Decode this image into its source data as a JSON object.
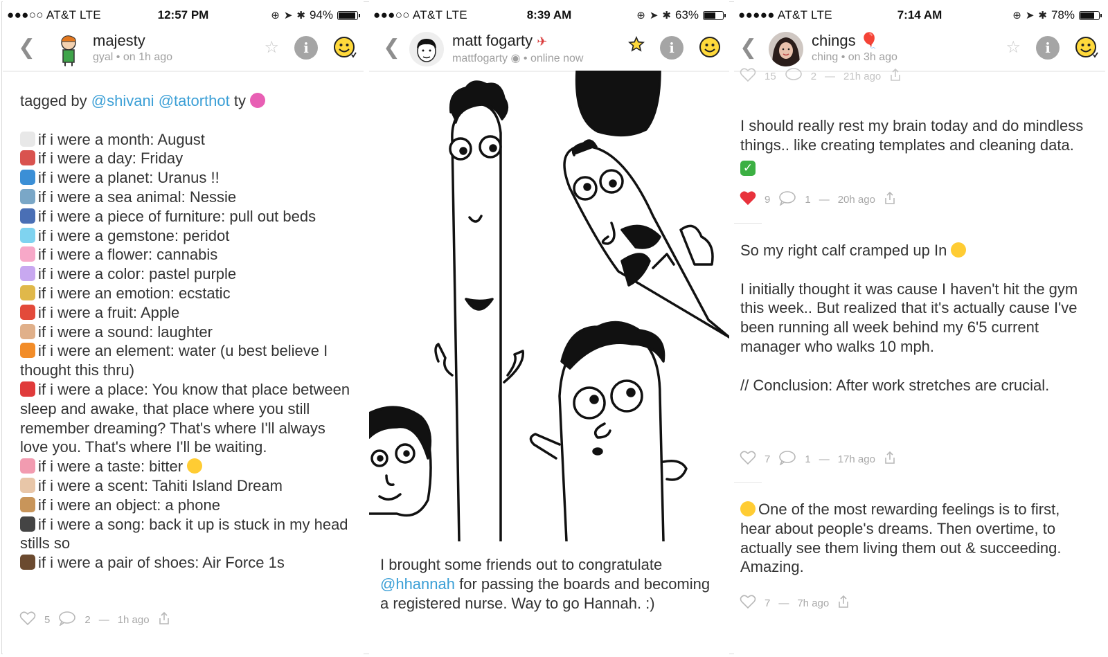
{
  "panels": [
    {
      "status": {
        "carrier": "●●●○○ AT&T   LTE",
        "time": "12:57 PM",
        "battery": "94%",
        "battery_level": 0.94
      },
      "nav": {
        "name": "majesty",
        "sub": "gyal • on 1h ago"
      },
      "post": {
        "intro_prefix": "tagged by ",
        "mention1": "@shivani",
        "mention2": "@tatorthot",
        "intro_suffix": " ty",
        "lines": [
          "if i were a month: August",
          "if i were a day: Friday",
          "if i were a planet: Uranus !!",
          "if i were a sea animal: Nessie",
          "if i were a piece of furniture: pull out beds",
          "if i were a gemstone: peridot",
          "if i were a flower: cannabis",
          "if i were a color: pastel purple",
          "if i were an emotion: ecstatic",
          "if i were a fruit: Apple",
          "if i were a sound: laughter",
          "if i were an element: water (u best believe I thought this thru)",
          "if i were a place: You know that place between sleep and awake, that place where you still remember dreaming? That's where I'll always love you. That's where I'll be waiting.",
          "if i were a taste: bitter",
          "if i were a scent: Tahiti Island Dream",
          "if i were an object: a phone",
          "if i were a song: back it up is stuck in my head stills so",
          "if i were a pair of shoes: Air Force 1s"
        ],
        "likes": "5",
        "comments": "2",
        "time": "1h ago"
      }
    },
    {
      "status": {
        "carrier": "●●●○○ AT&T   LTE",
        "time": "8:39 AM",
        "battery": "63%",
        "battery_level": 0.63
      },
      "nav": {
        "name": "matt fogarty",
        "handle": "mattfogarty",
        "sub": "• online now"
      },
      "post": {
        "text_prefix": "I brought some friends out to congratulate ",
        "mention": "@hhannah",
        "text_suffix": " for passing the boards and becoming a registered nurse. Way to go Hannah. :)"
      }
    },
    {
      "status": {
        "carrier": "●●●●● AT&T   LTE",
        "time": "7:14 AM",
        "battery": "78%",
        "battery_level": 0.78
      },
      "nav": {
        "name": "chings",
        "sub": "ching • on 3h ago"
      },
      "top_meta": {
        "likes": "15",
        "comments": "2",
        "time": "21h ago"
      },
      "posts": [
        {
          "text": "I should really rest my brain today and do mindless things.. like creating templates and cleaning data.",
          "likes": "9",
          "comments": "1",
          "time": "20h ago",
          "liked": true
        },
        {
          "text1": "So my right calf cramped up In",
          "text2": "I initially thought it was cause I haven't hit the gym this week.. But realized that it's actually cause I've been running all week behind my 6'5 current manager who walks 10 mph.",
          "text3": "// Conclusion: After work stretches are crucial.",
          "likes": "7",
          "comments": "1",
          "time": "17h ago"
        },
        {
          "text": "One of the most rewarding feelings is to first, hear about people's dreams. Then overtime, to actually see them living them out & succeeding. Amazing.",
          "likes": "7",
          "time": "7h ago"
        }
      ]
    }
  ]
}
